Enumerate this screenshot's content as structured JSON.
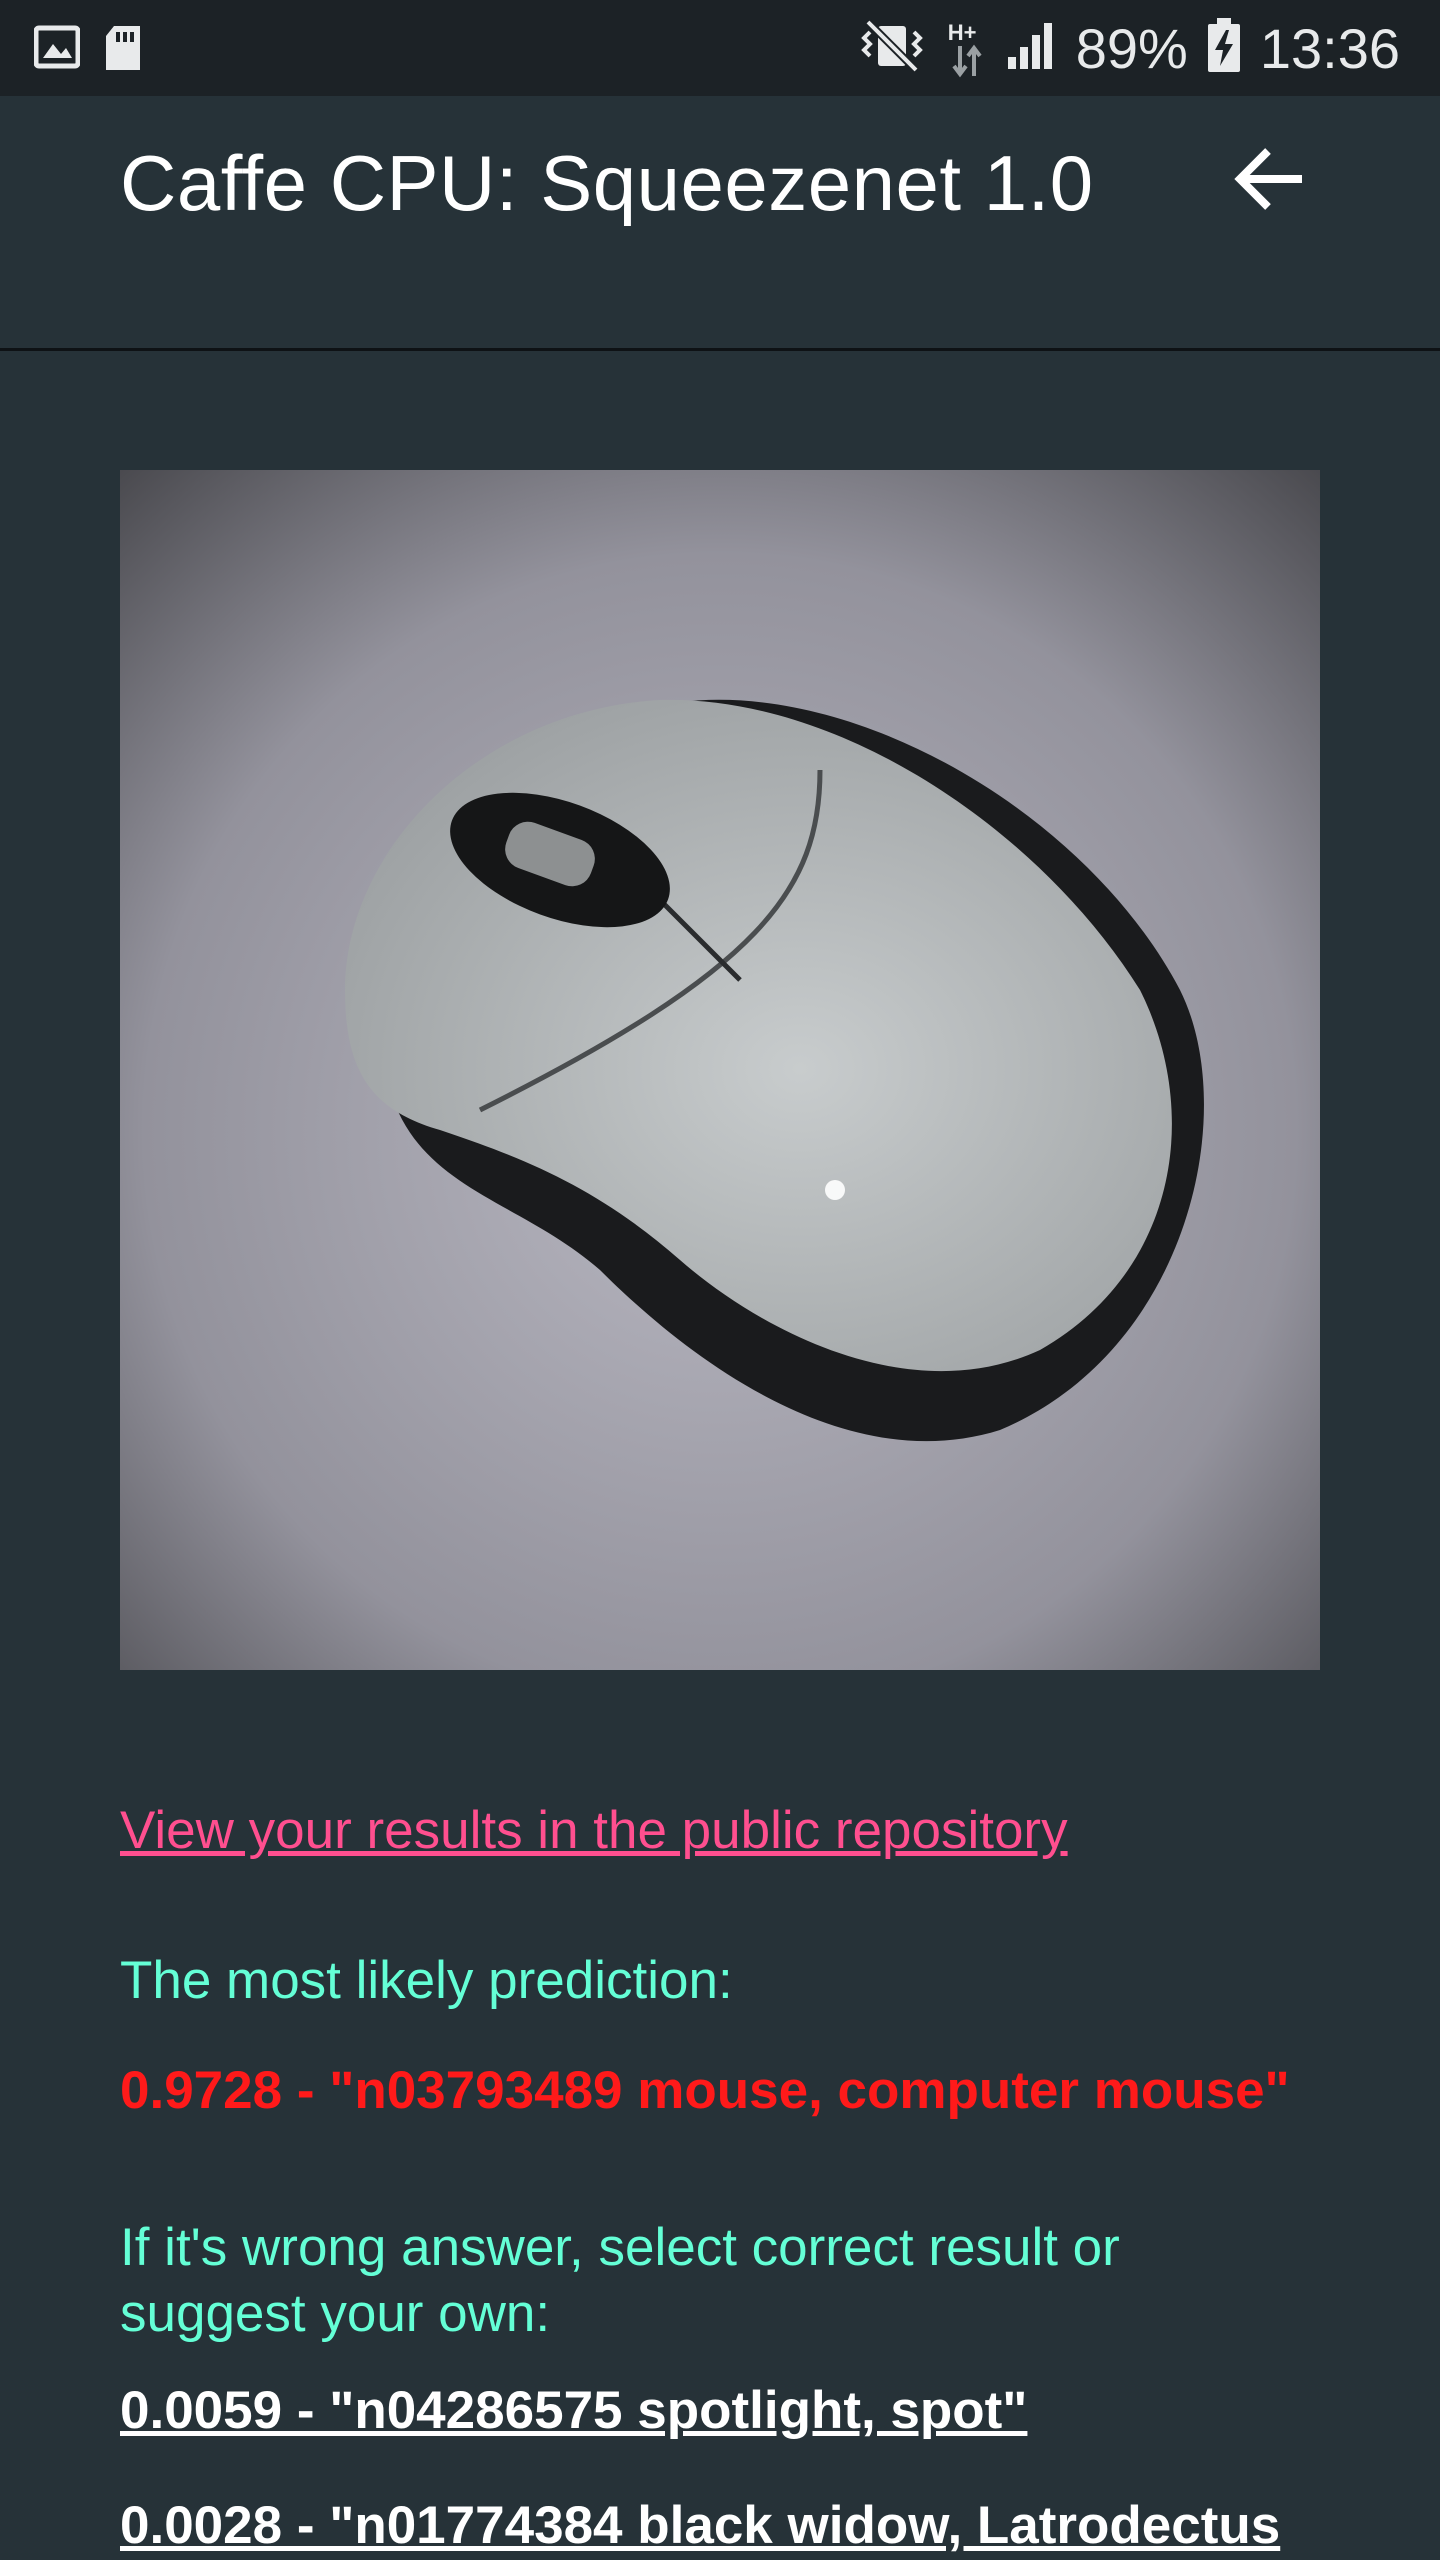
{
  "status_bar": {
    "battery": "89%",
    "time": "13:36",
    "network": "H+",
    "icons": [
      "gallery-icon",
      "sd-card-icon",
      "vibrate-icon",
      "data-arrows-icon",
      "signal-icon",
      "battery-charging-icon"
    ]
  },
  "app_bar": {
    "title": "Caffe CPU: Squeezenet 1.0",
    "back_icon": "arrow-back-icon"
  },
  "content": {
    "repo_link": "View your results in the public repository",
    "prediction_label": "The most likely prediction:",
    "prediction": "0.9728 - \"n03793489 mouse, computer mouse\"",
    "wrong_prompt": "If it's wrong answer, select correct result or suggest your own:",
    "options": [
      "0.0059 - \"n04286575 spotlight, spot\"",
      "0.0028 - \"n01774384 black widow, Latrodectus"
    ]
  },
  "colors": {
    "background": "#263238",
    "status_bar": "#1c2226",
    "link": "#ff4f8f",
    "label": "#64ffd6",
    "prediction": "#ff1a1a",
    "option": "#ffffff"
  }
}
